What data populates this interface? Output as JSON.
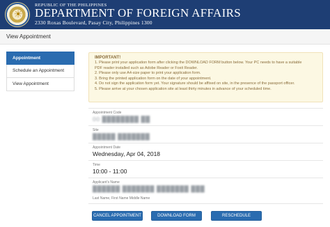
{
  "header": {
    "republic": "REPUBLIC OF THE PHILIPPINES",
    "title": "DEPARTMENT OF FOREIGN AFFAIRS",
    "address": "2330 Roxas Boulevard, Pasay City, Philippines 1300",
    "seal_icon": "dfa-seal-icon"
  },
  "page": {
    "title": "View Appointment"
  },
  "sidebar": {
    "items": [
      {
        "label": "Appointment",
        "active": true
      },
      {
        "label": "Schedule an Appointment",
        "active": false
      },
      {
        "label": "View Appointment",
        "active": false
      }
    ]
  },
  "notice": {
    "heading": "IMPORTANT!",
    "lines": [
      "1. Please print your application form after clicking the DOWNLOAD FORM button below. Your PC needs to have a suitable",
      "PDF reader installed such as Adobe Reader or Foxit Reader.",
      "2. Please only use A4-size paper to print your application form.",
      "3. Bring the printed application form on the date of your appointment.",
      "4. Do not sign the application form yet. Your signature should be affixed on site, in the presence of the passport officer.",
      "5. Please arrive at your chosen application site at least thirty minutes in advance of your scheduled time."
    ]
  },
  "details": {
    "code": {
      "label": "Appointment Code",
      "value": "00 ████████ ██"
    },
    "site": {
      "label": "Site",
      "value": "█████ ███████"
    },
    "date": {
      "label": "Appointment Date",
      "value": "Wednesday, Apr 04, 2018"
    },
    "time": {
      "label": "Time",
      "value": "10:00 - 11:00"
    },
    "name": {
      "label": "Applicant's Name",
      "value": "██████ ███████ ███████ ███",
      "note": "Last Name, First Name Middle Name"
    }
  },
  "buttons": {
    "cancel": "CANCEL APPOINTMENT",
    "download": "DOWNLOAD FORM",
    "reschedule": "RESCHEDULE"
  },
  "colors": {
    "header_bg": "#1e3e74",
    "accent": "#2a6cb0",
    "notice_bg": "#fcf8e3",
    "notice_text": "#8a6d3b"
  }
}
